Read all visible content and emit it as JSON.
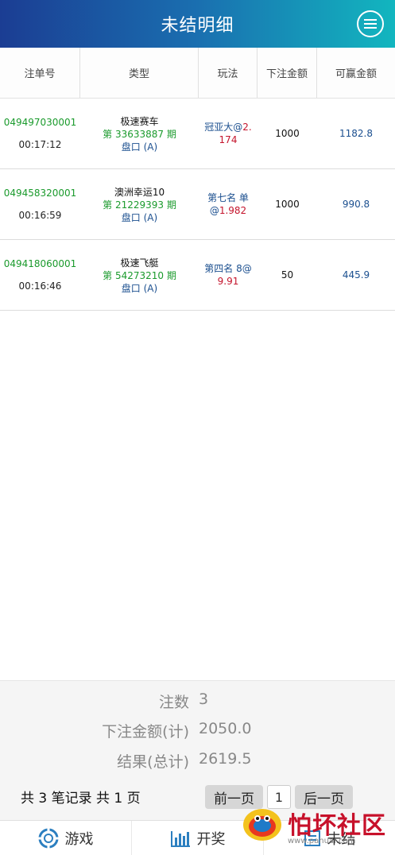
{
  "header": {
    "title": "未结明细",
    "menu_icon": "menu-icon"
  },
  "columns": [
    "注单号",
    "类型",
    "玩法",
    "下注金额",
    "可赢金额"
  ],
  "rows": [
    {
      "no": "049497030001",
      "time": "00:17:12",
      "game": "极速赛车",
      "period": "第 33633887 期",
      "pan": "盘口 (A)",
      "play_prefix": "冠亚大@",
      "odds": "2.174",
      "amount": "1000",
      "win": "1182.8"
    },
    {
      "no": "049458320001",
      "time": "00:16:59",
      "game": "澳洲幸运10",
      "period": "第 21229393 期",
      "pan": "盘口 (A)",
      "play_prefix": "第七名 单@",
      "odds": "1.982",
      "amount": "1000",
      "win": "990.8"
    },
    {
      "no": "049418060001",
      "time": "00:16:46",
      "game": "极速飞艇",
      "period": "第 54273210 期",
      "pan": "盘口 (A)",
      "play_prefix": "第四名 8@",
      "odds": "9.91",
      "amount": "50",
      "win": "445.9"
    }
  ],
  "summary": {
    "count_label": "注数",
    "count": "3",
    "bet_label": "下注金额(计)",
    "bet": "2050.0",
    "result_label": "结果(总计)",
    "result": "2619.5",
    "records": "共 3 笔记录  共 1 页"
  },
  "pager": {
    "prev": "前一页",
    "page": "1",
    "next": "后一页"
  },
  "nav": [
    {
      "label": "游戏",
      "icon": "game-icon"
    },
    {
      "label": "开奖",
      "icon": "chart-icon"
    },
    {
      "label": "未结",
      "icon": "list-icon"
    }
  ],
  "watermark": {
    "text": "怕坏社区",
    "url": "www.pahuai.com"
  },
  "colors": {
    "header_start": "#1b3d93",
    "header_end": "#12b6bf",
    "green": "#1a9a2c",
    "blue": "#1b4f8f",
    "red": "#c4142c"
  }
}
